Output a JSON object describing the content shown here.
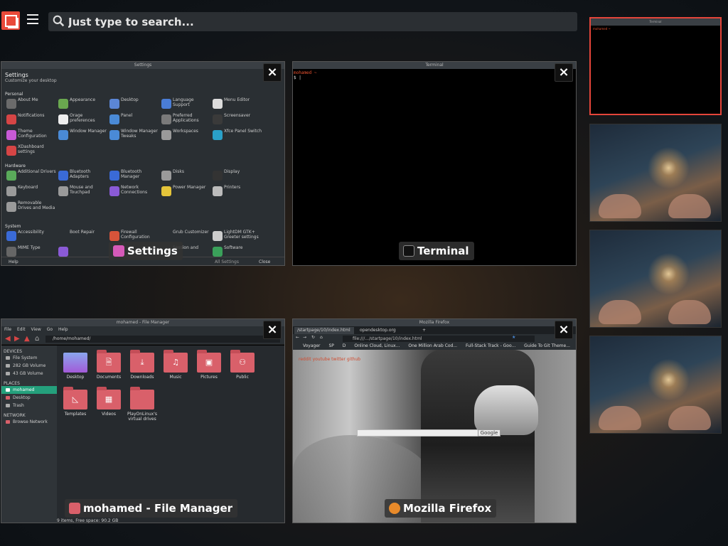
{
  "topbar": {
    "search_placeholder": "Just type to search..."
  },
  "windows": {
    "settings": {
      "titlebar": "Settings",
      "label": "Settings",
      "header_title": "Settings",
      "header_subtitle": "Customize your desktop",
      "categories": {
        "personal": "Personal",
        "hardware": "Hardware",
        "system": "System"
      },
      "items": [
        {
          "label": "About Me",
          "color": "#6b6b6b"
        },
        {
          "label": "Appearance",
          "color": "#6aa84f"
        },
        {
          "label": "Desktop",
          "color": "#5b86d6"
        },
        {
          "label": "Language Support",
          "color": "#4a7dd6"
        },
        {
          "label": "Menu Editor",
          "color": "#dcdcdc"
        },
        {
          "label": "Notifications",
          "color": "#d64545"
        },
        {
          "label": "Orage preferences",
          "color": "#eeeeee"
        },
        {
          "label": "Panel",
          "color": "#4a8ad6"
        },
        {
          "label": "Preferred Applications",
          "color": "#7a7a7a"
        },
        {
          "label": "Screensaver",
          "color": "#3a3a3a"
        },
        {
          "label": "Theme Configuration",
          "color": "#c85ad6"
        },
        {
          "label": "Window Manager",
          "color": "#4a8ad6"
        },
        {
          "label": "Window Manager Tweaks",
          "color": "#4a8ad6"
        },
        {
          "label": "Workspaces",
          "color": "#9a9a9a"
        },
        {
          "label": "Xfce Panel Switch",
          "color": "#2aa0c8"
        },
        {
          "label": "XDashboard settings",
          "color": "#d64545"
        },
        {
          "label": "Additional Drivers",
          "color": "#5aaa5a"
        },
        {
          "label": "Bluetooth Adapters",
          "color": "#3a6ad6"
        },
        {
          "label": "Bluetooth Manager",
          "color": "#3a6ad6"
        },
        {
          "label": "Disks",
          "color": "#9a9a9a"
        },
        {
          "label": "Display",
          "color": "#333333"
        },
        {
          "label": "Keyboard",
          "color": "#9a9a9a"
        },
        {
          "label": "Mouse and Touchpad",
          "color": "#9a9a9a"
        },
        {
          "label": "Network Connections",
          "color": "#8a5ad6"
        },
        {
          "label": "Power Manager",
          "color": "#e4c43a"
        },
        {
          "label": "Printers",
          "color": "#bbbbbb"
        },
        {
          "label": "Removable Drives and Media",
          "color": "#9a9a9a"
        },
        {
          "label": "Accessibility",
          "color": "#3a6ad6"
        },
        {
          "label": "Boot Repair",
          "color": "#2a2f33"
        },
        {
          "label": "Firewall Configuration",
          "color": "#d6543a"
        },
        {
          "label": "Grub Customizer",
          "color": "#2a2f33"
        },
        {
          "label": "LightDM GTK+ Greeter settings",
          "color": "#cccccc"
        },
        {
          "label": "MIME Type",
          "color": "#666666"
        },
        {
          "label": "",
          "color": "#8a5ad6"
        },
        {
          "label": "Session and",
          "color": "#2a2f33"
        },
        {
          "label": "Software",
          "color": "#3aa05a"
        }
      ],
      "footer_help": "Help",
      "footer_all_settings": "All Settings",
      "footer_close": "Close"
    },
    "terminal": {
      "titlebar": "Terminal",
      "label": "Terminal",
      "prompt": "mohamed ~",
      "line2": "$ |"
    },
    "file_manager": {
      "titlebar": "mohamed - File Manager",
      "label": "mohamed - File Manager",
      "menu": [
        "File",
        "Edit",
        "View",
        "Go",
        "Help"
      ],
      "path": "/home/mohamed/",
      "devices_header": "DEVICES",
      "devices": [
        "File System",
        "282 GB Volume",
        "43 GB Volume"
      ],
      "places_header": "PLACES",
      "places": [
        "mohamed",
        "Desktop",
        "Trash"
      ],
      "network_header": "NETWORK",
      "network": [
        "Browse Network"
      ],
      "folders": [
        {
          "name": "Desktop",
          "glyph": ""
        },
        {
          "name": "Documents",
          "glyph": "🗎"
        },
        {
          "name": "Downloads",
          "glyph": "⤓"
        },
        {
          "name": "Music",
          "glyph": "♫"
        },
        {
          "name": "Pictures",
          "glyph": "▣"
        },
        {
          "name": "Public",
          "glyph": "⚇"
        },
        {
          "name": "Templates",
          "glyph": "◺"
        },
        {
          "name": "Videos",
          "glyph": "▦"
        },
        {
          "name": "PlayOnLinux's virtual drives",
          "glyph": ""
        }
      ],
      "status": "9 items, Free space: 90.2 GB"
    },
    "firefox": {
      "titlebar": "Mozilla Firefox",
      "label": "Mozilla Firefox",
      "tabs": [
        "/startpage/10/index.html",
        "opendesktop.org"
      ],
      "new_tab": "+",
      "url": "file:///.../startpage/10/index.html",
      "bookmarks": [
        "Voyager",
        "SP",
        "D",
        "Online Cloud, Linux...",
        "One Million Arab Cod...",
        "Full-Stack Track - Goo...",
        "Guide To Git Theme..."
      ],
      "page_links": "reddit  youtube  twitter  github",
      "search_button": "Google"
    }
  },
  "workspaces": [
    {
      "active": true,
      "title": "Terminal",
      "prompt": "mohamed ~"
    },
    {
      "active": false
    },
    {
      "active": false
    },
    {
      "active": false
    }
  ],
  "colors": {
    "accent": "#e4453a",
    "selection": "#24a07c",
    "folder": "#d9606a",
    "prompt": "#e9512f"
  }
}
